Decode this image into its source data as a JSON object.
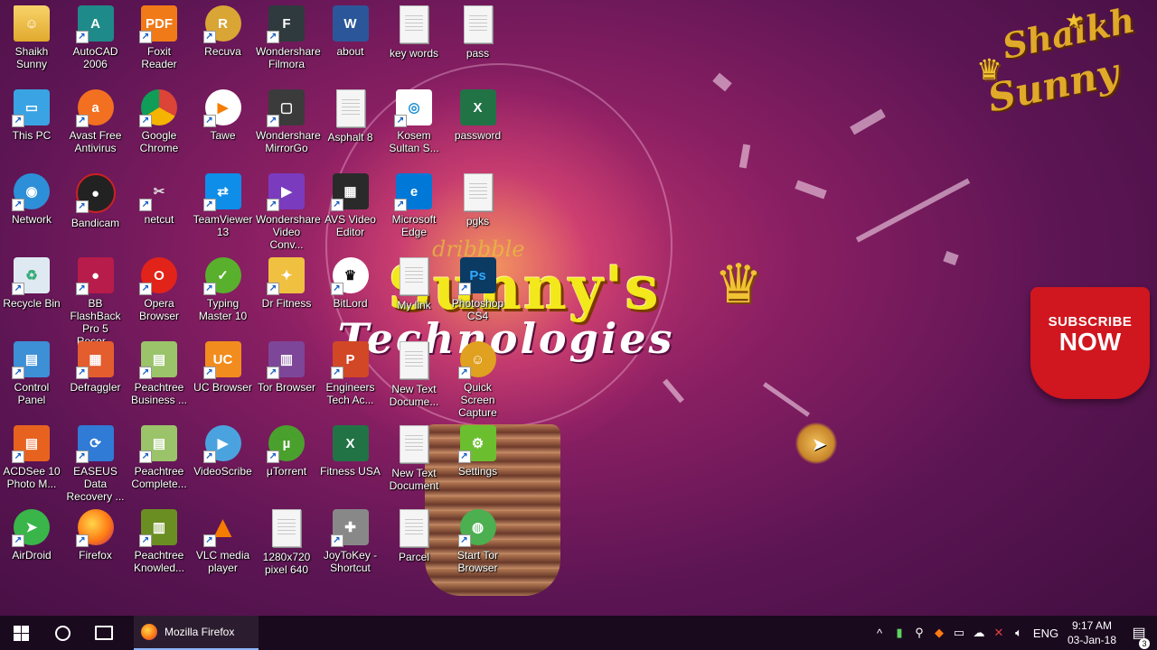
{
  "wallpaper": {
    "brand_title": "Sunny's",
    "brand_subtitle": "Technologies",
    "dribbble_text": "dribbble",
    "logo_line1": "Shaikh",
    "logo_line2": "Sunny",
    "subscribe_line1": "SUBSCRIBE",
    "subscribe_line2": "NOW"
  },
  "desktop_icons": [
    {
      "label": "Shaikh Sunny",
      "icon": "user-folder-icon"
    },
    {
      "label": "AutoCAD 2006",
      "icon": "autocad-icon"
    },
    {
      "label": "Foxit Reader",
      "icon": "pdf-icon"
    },
    {
      "label": "Recuva",
      "icon": "recuva-icon"
    },
    {
      "label": "Wondershare Filmora",
      "icon": "filmora-icon"
    },
    {
      "label": "about",
      "icon": "word-doc-icon"
    },
    {
      "label": "key words",
      "icon": "text-doc-icon"
    },
    {
      "label": "pass",
      "icon": "text-doc-icon"
    },
    {
      "label": "This PC",
      "icon": "computer-icon"
    },
    {
      "label": "Avast Free Antivirus",
      "icon": "avast-icon"
    },
    {
      "label": "Google Chrome",
      "icon": "chrome-icon"
    },
    {
      "label": "Tawe",
      "icon": "tawe-icon"
    },
    {
      "label": "Wondershare MirrorGo",
      "icon": "mirrorgo-icon"
    },
    {
      "label": "Asphalt 8",
      "icon": "text-doc-icon"
    },
    {
      "label": "Kosem Sultan S...",
      "icon": "media-icon"
    },
    {
      "label": "password",
      "icon": "excel-icon"
    },
    {
      "label": "Network",
      "icon": "network-icon"
    },
    {
      "label": "Bandicam",
      "icon": "bandicam-icon"
    },
    {
      "label": "netcut",
      "icon": "scissors-icon"
    },
    {
      "label": "TeamViewer 13",
      "icon": "teamviewer-icon"
    },
    {
      "label": "Wondershare Video Conv...",
      "icon": "video-converter-icon"
    },
    {
      "label": "AVS Video Editor",
      "icon": "film-icon"
    },
    {
      "label": "Microsoft Edge",
      "icon": "edge-icon"
    },
    {
      "label": "pgks",
      "icon": "text-doc-icon"
    },
    {
      "label": "Recycle Bin",
      "icon": "recycle-bin-icon"
    },
    {
      "label": "BB FlashBack Pro 5 Recor...",
      "icon": "flashback-icon"
    },
    {
      "label": "Opera Browser",
      "icon": "opera-icon"
    },
    {
      "label": "Typing Master 10",
      "icon": "typingmaster-icon"
    },
    {
      "label": "Dr Fitness",
      "icon": "fitness-icon"
    },
    {
      "label": "BitLord",
      "icon": "bitlord-icon"
    },
    {
      "label": "My link",
      "icon": "text-doc-icon"
    },
    {
      "label": "Photoshop CS4",
      "icon": "photoshop-icon"
    },
    {
      "label": "Control Panel",
      "icon": "control-panel-icon"
    },
    {
      "label": "Defraggler",
      "icon": "defraggler-icon"
    },
    {
      "label": "Peachtree Business ...",
      "icon": "peachtree-icon"
    },
    {
      "label": "UC Browser",
      "icon": "uc-browser-icon"
    },
    {
      "label": "Tor Browser",
      "icon": "tor-icon"
    },
    {
      "label": "Engineers Tech Ac...",
      "icon": "powerpoint-icon"
    },
    {
      "label": "New Text Docume...",
      "icon": "text-doc-icon"
    },
    {
      "label": "Quick Screen Capture",
      "icon": "screen-capture-icon"
    },
    {
      "label": "ACDSee 10 Photo M...",
      "icon": "acdsee-icon"
    },
    {
      "label": "EASEUS Data Recovery ...",
      "icon": "easeus-icon"
    },
    {
      "label": "Peachtree Complete...",
      "icon": "peachtree-icon"
    },
    {
      "label": "VideoScribe",
      "icon": "videoscribe-icon"
    },
    {
      "label": "μTorrent",
      "icon": "utorrent-icon"
    },
    {
      "label": "Fitness USA",
      "icon": "excel-icon"
    },
    {
      "label": "New Text Document",
      "icon": "text-doc-icon"
    },
    {
      "label": "Settings",
      "icon": "settings-icon"
    },
    {
      "label": "AirDroid",
      "icon": "airdroid-icon"
    },
    {
      "label": "Firefox",
      "icon": "firefox-icon"
    },
    {
      "label": "Peachtree Knowled...",
      "icon": "books-icon"
    },
    {
      "label": "VLC media player",
      "icon": "vlc-icon"
    },
    {
      "label": "1280x720 pixel 640",
      "icon": "text-doc-icon"
    },
    {
      "label": "JoyToKey - Shortcut",
      "icon": "joystick-icon"
    },
    {
      "label": "Parcel",
      "icon": "text-doc-icon"
    },
    {
      "label": "Start Tor Browser",
      "icon": "globe-icon"
    }
  ],
  "taskbar": {
    "active_app_label": "Mozilla Firefox",
    "language": "ENG",
    "time": "9:17 AM",
    "date": "03-Jan-18",
    "notification_count": "3"
  }
}
